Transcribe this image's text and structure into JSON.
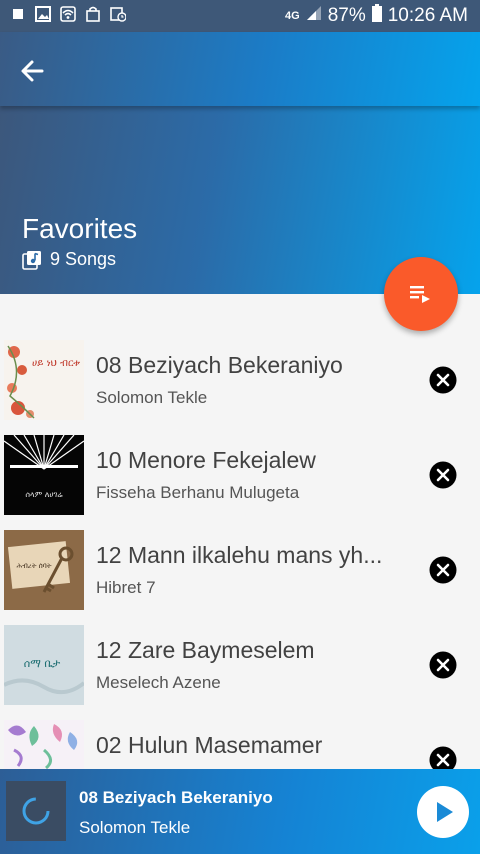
{
  "status_bar": {
    "network": "4G",
    "battery": "87%",
    "time": "10:26 AM",
    "icons": [
      "square-notification-icon",
      "gallery-icon",
      "wifi-icon",
      "shopping-bag-icon",
      "alarm-icon"
    ]
  },
  "header": {
    "title": "Favorites",
    "song_count": "9 Songs",
    "back_icon": "arrow-left-icon"
  },
  "fab": {
    "icon": "queue-music-icon",
    "color": "#fa5a2a"
  },
  "songs": [
    {
      "title": "08 Beziyach Bekeraniyo",
      "artist": "Solomon Tekle",
      "art_text": "ሀይ ነህ ብርቱ"
    },
    {
      "title": "10 Menore Fekejalew",
      "artist": "Fisseha Berhanu Mulugeta",
      "art_text": "ሰላም ለሀገሬ"
    },
    {
      "title": "12 Mann ilkalehu mans yh...",
      "artist": "Hibret 7",
      "art_text": "ሕብረት ሰባት"
    },
    {
      "title": "12 Zare Baymeselem",
      "artist": "Meselech Azene",
      "art_text": "ሰማ ቤታ"
    },
    {
      "title": "02  Hulun Masemamer",
      "artist": "",
      "art_text": ""
    }
  ],
  "player": {
    "title": "08 Beziyach Bekeraniyo",
    "artist": "Solomon Tekle"
  },
  "colors": {
    "accent": "#fa5a2a",
    "header_start": "#3d5679",
    "header_end": "#05a3ec"
  }
}
